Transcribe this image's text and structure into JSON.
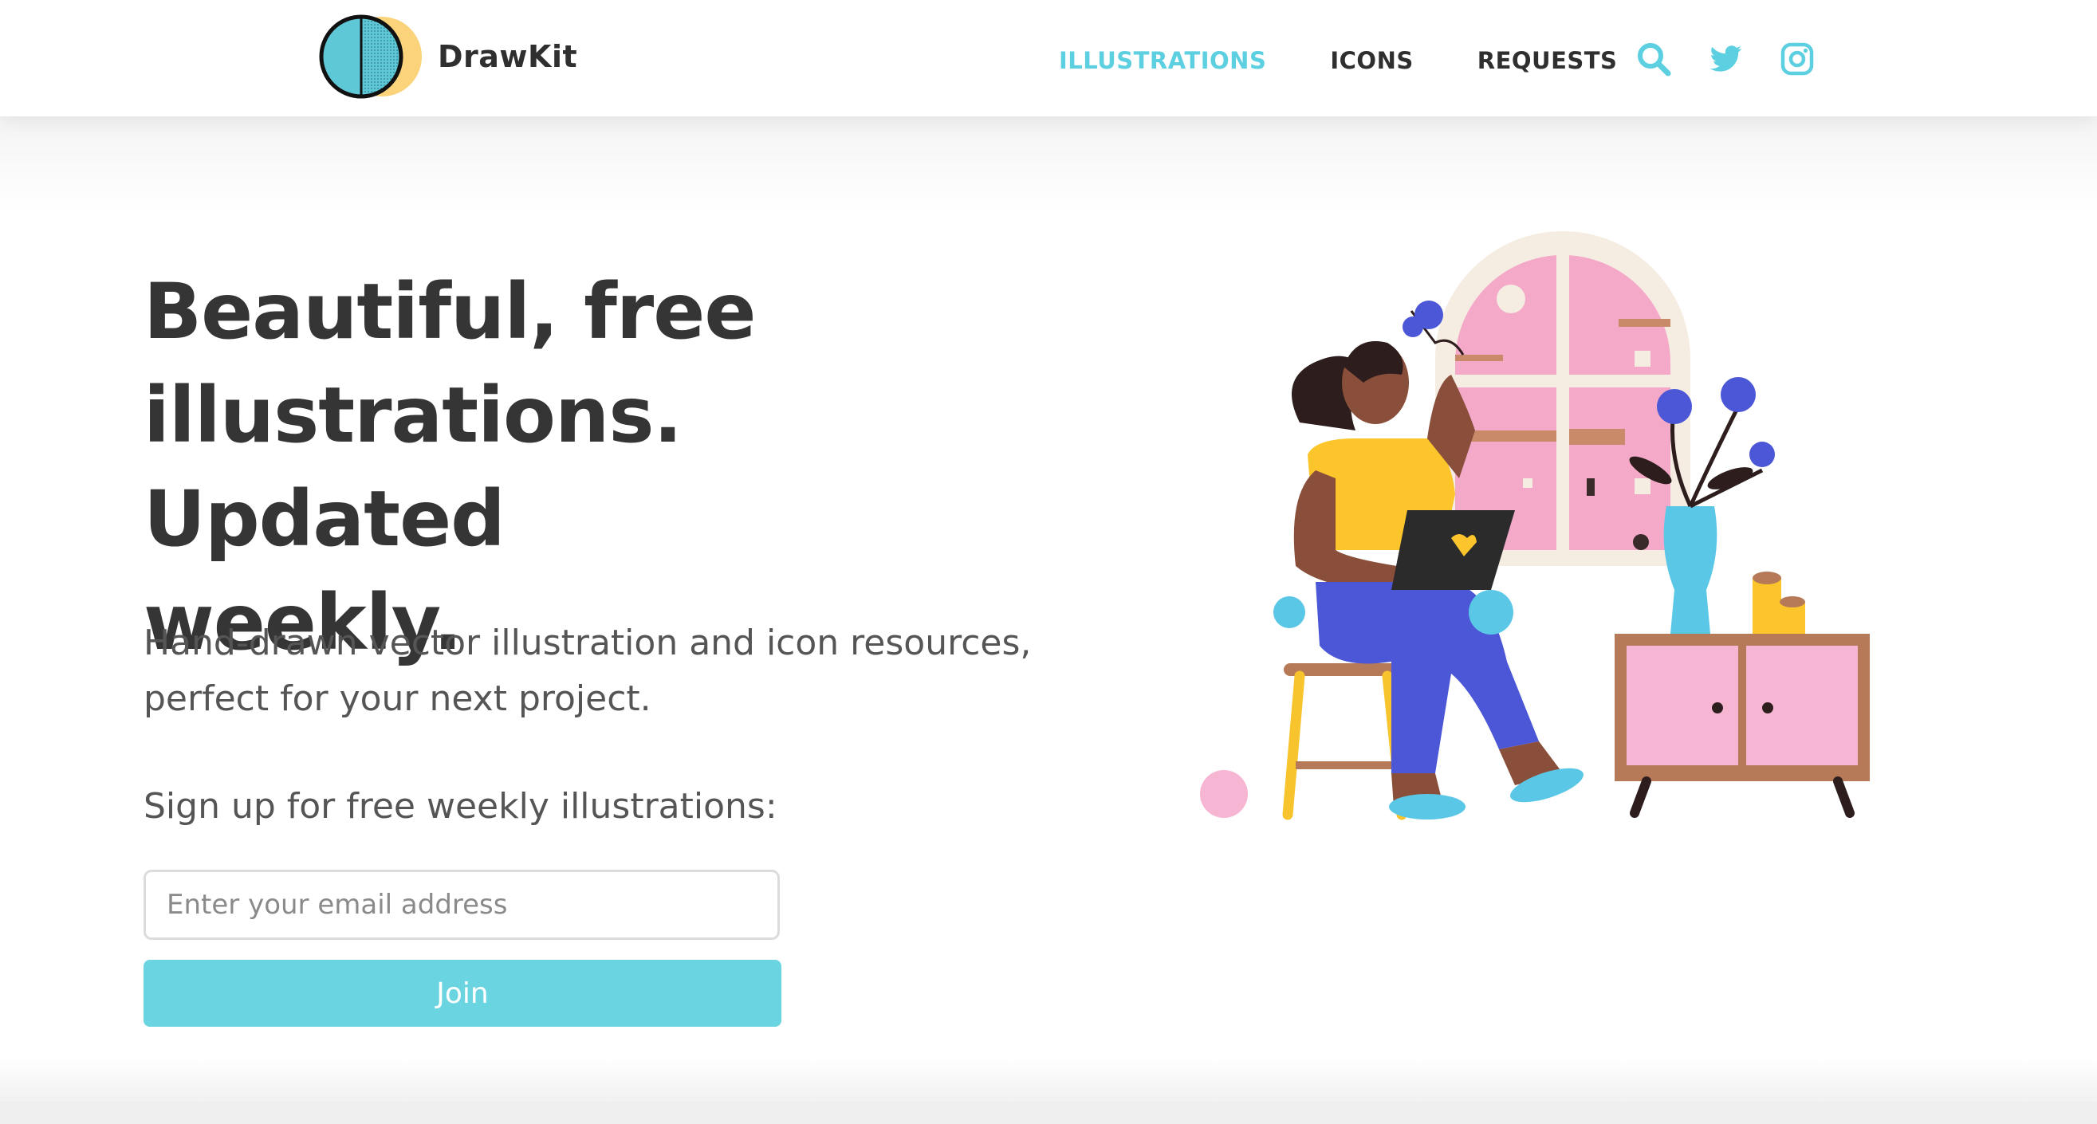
{
  "brand": {
    "name": "DrawKit",
    "logo_icon": "drawkit-logo-icon"
  },
  "nav": {
    "items": [
      {
        "label": "ILLUSTRATIONS",
        "active": true
      },
      {
        "label": "ICONS",
        "active": false
      },
      {
        "label": "REQUESTS",
        "active": false
      }
    ],
    "icons": [
      "search-icon",
      "twitter-icon",
      "instagram-icon"
    ]
  },
  "hero": {
    "headline_lines": [
      "Beautiful, free",
      "illustrations. Updated",
      "weekly."
    ],
    "subtext_lines": [
      "Hand-drawn vector illustration and icon resources,",
      "perfect for your next project."
    ],
    "signup_label": "Sign up for free weekly illustrations:",
    "email_placeholder": "Enter your email address",
    "email_value": "",
    "join_label": "Join"
  },
  "colors": {
    "accent": "#5ccfe0",
    "button": "#6ad5e1",
    "heading": "#353535",
    "body": "#555555"
  }
}
